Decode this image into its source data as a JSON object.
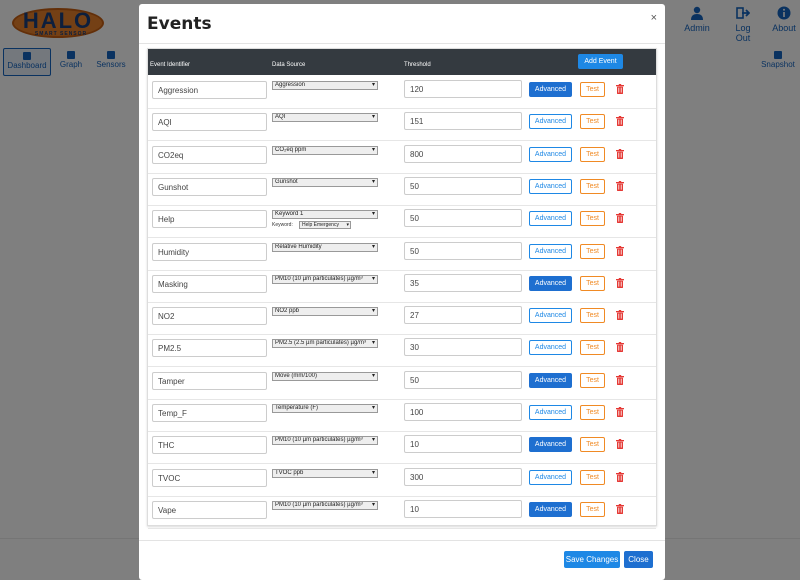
{
  "logo": {
    "name": "HALO",
    "tagline": "SMART SENSOR"
  },
  "header_buttons": [
    {
      "label": "Admin",
      "icon": "user-icon"
    },
    {
      "label": "Log Out",
      "icon": "logout-icon"
    },
    {
      "label": "About",
      "icon": "info-icon"
    }
  ],
  "nav_tabs": [
    {
      "label": "Dashboard",
      "active": true
    },
    {
      "label": "Graph",
      "active": false
    },
    {
      "label": "Sensors",
      "active": false
    },
    {
      "label": "Snapshot",
      "active": false
    }
  ],
  "modal": {
    "title": "Events",
    "close_label": "×",
    "columns": [
      "Event Identifier",
      "Data Source",
      "Threshold"
    ],
    "add_event_label": "Add Event",
    "advanced_label": "Advanced",
    "test_label": "Test",
    "keyword_label": "Keyword:",
    "rows": [
      {
        "id": "Aggression",
        "source": "Aggression",
        "threshold": "120",
        "advanced_active": true
      },
      {
        "id": "AQI",
        "source": "AQI",
        "threshold": "151",
        "advanced_active": false
      },
      {
        "id": "CO2eq",
        "source": "CO₂eq ppm",
        "threshold": "800",
        "advanced_active": false
      },
      {
        "id": "Gunshot",
        "source": "Gunshot",
        "threshold": "50",
        "advanced_active": false
      },
      {
        "id": "Help",
        "source": "Keyword 1",
        "threshold": "50",
        "advanced_active": false,
        "keyword": "Help Emergency"
      },
      {
        "id": "Humidity",
        "source": "Relative Humidity",
        "threshold": "50",
        "advanced_active": false
      },
      {
        "id": "Masking",
        "source": "PM10 (10 µm particulates) µg/m³",
        "threshold": "35",
        "advanced_active": true
      },
      {
        "id": "NO2",
        "source": "NO2 ppb",
        "threshold": "27",
        "advanced_active": false
      },
      {
        "id": "PM2.5",
        "source": "PM2.5 (2.5 µm particulates) µg/m³",
        "threshold": "30",
        "advanced_active": false
      },
      {
        "id": "Tamper",
        "source": "Move (mm/100)",
        "threshold": "50",
        "advanced_active": true
      },
      {
        "id": "Temp_F",
        "source": "Temperature (F)",
        "threshold": "100",
        "advanced_active": false
      },
      {
        "id": "THC",
        "source": "PM10 (10 µm particulates) µg/m³",
        "threshold": "10",
        "advanced_active": true
      },
      {
        "id": "TVOC",
        "source": "TVOC ppb",
        "threshold": "300",
        "advanced_active": false
      },
      {
        "id": "Vape",
        "source": "PM10 (10 µm particulates) µg/m³",
        "threshold": "10",
        "advanced_active": true
      }
    ],
    "save_label": "Save Changes",
    "close_button_label": "Close"
  },
  "colors": {
    "primary": "#1e88e5",
    "primary_dark": "#1e6fd0",
    "test": "#f08a24",
    "danger": "#e53935",
    "header_dark": "#343a40"
  }
}
